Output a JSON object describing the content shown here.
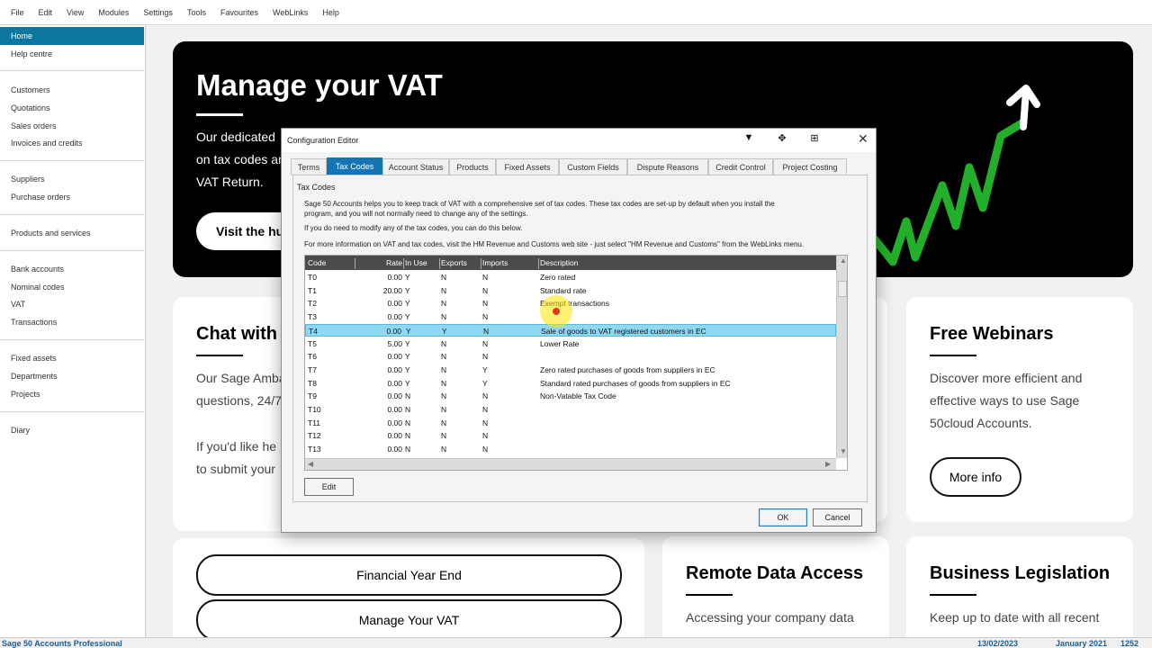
{
  "menubar": [
    "File",
    "Edit",
    "View",
    "Modules",
    "Settings",
    "Tools",
    "Favourites",
    "WebLinks",
    "Help"
  ],
  "sidebar": {
    "items": [
      "Home",
      "Help centre",
      "Customers",
      "Quotations",
      "Sales orders",
      "Invoices and credits",
      "Suppliers",
      "Purchase orders",
      "Products and services",
      "Bank accounts",
      "Nominal codes",
      "VAT",
      "Transactions",
      "Fixed assets",
      "Departments",
      "Projects",
      "Diary"
    ],
    "active": "Home"
  },
  "hero": {
    "title": "Manage your VAT",
    "lines": [
      "Our dedicated",
      "on tax codes ar",
      "VAT Return."
    ],
    "button": "Visit the hub"
  },
  "cards": {
    "chat": {
      "title": "Chat with",
      "lines": [
        "Our Sage Amba",
        "questions, 24/7",
        "If you'd like he",
        "to submit your"
      ]
    },
    "webinars": {
      "title": "Free Webinars",
      "lines": [
        "Discover more efficient and",
        "effective ways to use Sage",
        "50cloud Accounts."
      ],
      "button": "More info"
    },
    "links": {
      "financial_year_end": "Financial Year End",
      "manage_vat": "Manage Your VAT"
    },
    "remote": {
      "title": "Remote Data Access",
      "text": "Accessing your company data"
    },
    "legislation": {
      "title": "Business Legislation",
      "text": "Keep up to date with all recent"
    }
  },
  "statusbar": {
    "product": "Sage 50 Accounts Professional",
    "date": "13/02/2023",
    "period": "January 2021",
    "number": "1252"
  },
  "dialog": {
    "title": "Configuration Editor",
    "tabs": [
      "Terms",
      "Tax Codes",
      "Account Status",
      "Products",
      "Fixed Assets",
      "Custom Fields",
      "Dispute Reasons",
      "Credit Control",
      "Project Costing"
    ],
    "active_tab": "Tax Codes",
    "panel_title": "Tax Codes",
    "intro_1": "Sage 50 Accounts helps you to keep track of VAT with a comprehensive set of tax codes. These tax codes are set-up by default when you install the",
    "intro_2": "program, and you will not normally need to change any of the settings.",
    "intro_3": "If you do need to modify any of the tax codes, you can do this below.",
    "intro_4": "For more information on VAT and tax codes, visit the HM Revenue and Customs web site - just select \"HM Revenue and Customs\" from the WebLinks menu.",
    "columns": [
      "Code",
      "Rate",
      "In Use",
      "Exports",
      "Imports",
      "Description"
    ],
    "rows": [
      {
        "code": "T0",
        "rate": "0.00",
        "in_use": "Y",
        "exports": "N",
        "imports": "N",
        "desc": "Zero rated"
      },
      {
        "code": "T1",
        "rate": "20.00",
        "in_use": "Y",
        "exports": "N",
        "imports": "N",
        "desc": "Standard rate"
      },
      {
        "code": "T2",
        "rate": "0.00",
        "in_use": "Y",
        "exports": "N",
        "imports": "N",
        "desc": "Exempt transactions"
      },
      {
        "code": "T3",
        "rate": "0.00",
        "in_use": "Y",
        "exports": "N",
        "imports": "N",
        "desc": ""
      },
      {
        "code": "T4",
        "rate": "0.00",
        "in_use": "Y",
        "exports": "Y",
        "imports": "N",
        "desc": "Sale of goods to VAT registered customers in EC"
      },
      {
        "code": "T5",
        "rate": "5.00",
        "in_use": "Y",
        "exports": "N",
        "imports": "N",
        "desc": "Lower Rate"
      },
      {
        "code": "T6",
        "rate": "0.00",
        "in_use": "Y",
        "exports": "N",
        "imports": "N",
        "desc": ""
      },
      {
        "code": "T7",
        "rate": "0.00",
        "in_use": "Y",
        "exports": "N",
        "imports": "Y",
        "desc": "Zero rated purchases of goods from suppliers in EC"
      },
      {
        "code": "T8",
        "rate": "0.00",
        "in_use": "Y",
        "exports": "N",
        "imports": "Y",
        "desc": "Standard rated purchases of goods from suppliers in EC"
      },
      {
        "code": "T9",
        "rate": "0.00",
        "in_use": "N",
        "exports": "N",
        "imports": "N",
        "desc": "Non-Vatable Tax Code"
      },
      {
        "code": "T10",
        "rate": "0.00",
        "in_use": "N",
        "exports": "N",
        "imports": "N",
        "desc": ""
      },
      {
        "code": "T11",
        "rate": "0.00",
        "in_use": "N",
        "exports": "N",
        "imports": "N",
        "desc": ""
      },
      {
        "code": "T12",
        "rate": "0.00",
        "in_use": "N",
        "exports": "N",
        "imports": "N",
        "desc": ""
      },
      {
        "code": "T13",
        "rate": "0.00",
        "in_use": "N",
        "exports": "N",
        "imports": "N",
        "desc": ""
      }
    ],
    "selected_code": "T4",
    "edit_button": "Edit",
    "ok_button": "OK",
    "cancel_button": "Cancel"
  },
  "colors": {
    "sidebar_active": "#0e77a0",
    "tab_active": "#1574b3",
    "row_selected": "#8fd8f4",
    "grid_header": "#4b4b4b",
    "hero_bg": "#000000",
    "chart_green": "#22b02b"
  }
}
